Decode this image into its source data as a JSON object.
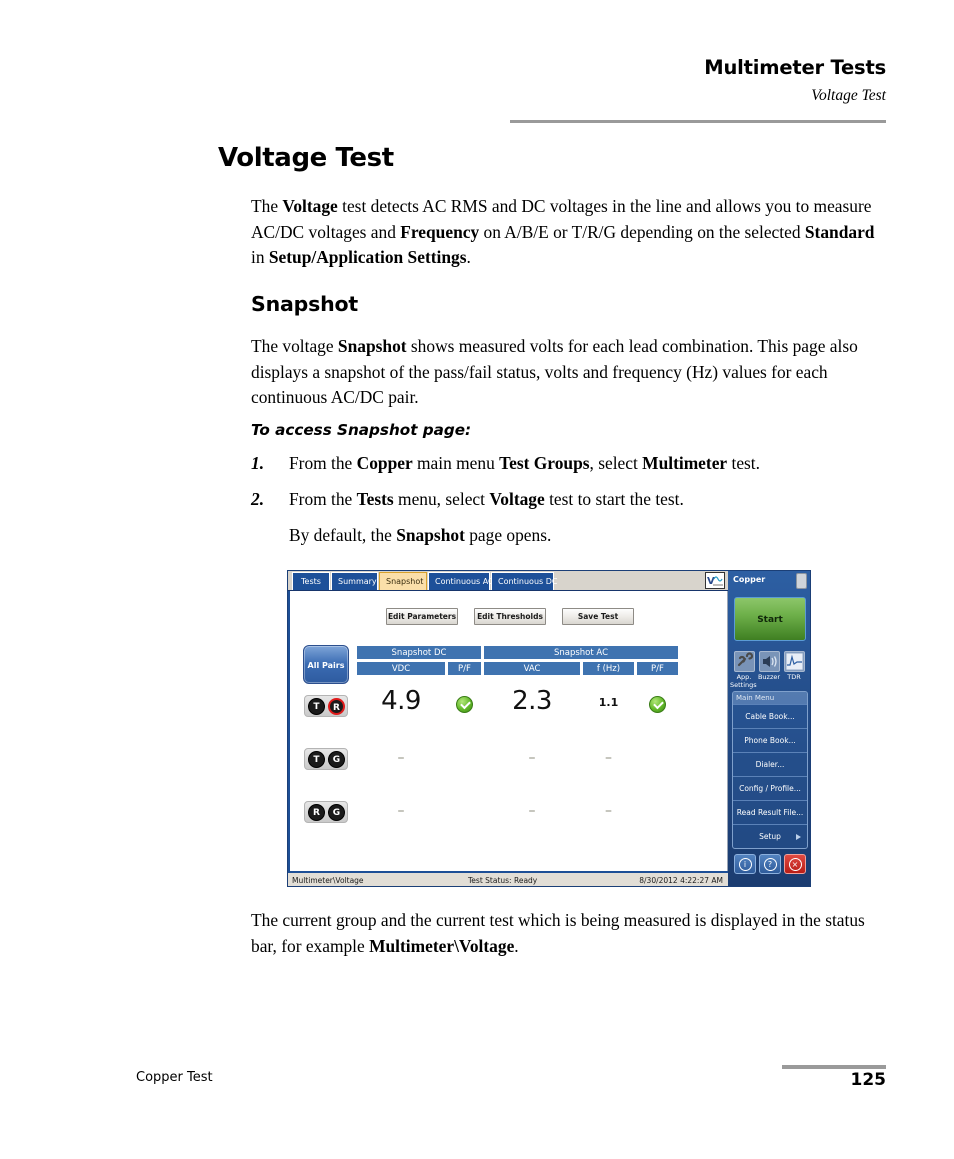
{
  "header": {
    "title": "Multimeter Tests",
    "subtitle": "Voltage Test"
  },
  "page_title": "Voltage Test",
  "intro_paragraph": {
    "parts": [
      {
        "t": "The ",
        "b": false
      },
      {
        "t": "Voltage",
        "b": true
      },
      {
        "t": " test detects AC RMS and DC voltages in the line and allows you to measure AC/DC voltages and ",
        "b": false
      },
      {
        "t": "Frequency",
        "b": true
      },
      {
        "t": " on A/B/E or T/R/G depending on the selected ",
        "b": false
      },
      {
        "t": "Standard",
        "b": true
      },
      {
        "t": " in ",
        "b": false
      },
      {
        "t": "Setup/Application Settings",
        "b": true
      },
      {
        "t": ".",
        "b": false
      }
    ]
  },
  "snapshot_heading": "Snapshot",
  "snapshot_paragraph": {
    "parts": [
      {
        "t": "The voltage ",
        "b": false
      },
      {
        "t": "Snapshot",
        "b": true
      },
      {
        "t": " shows measured volts for each lead combination. This page also displays a snapshot of the pass/fail status, volts and frequency (Hz) values for each continuous AC/DC pair.",
        "b": false
      }
    ]
  },
  "procedure_title": "To access Snapshot page:",
  "steps": [
    {
      "num": "1.",
      "parts": [
        {
          "t": "From the ",
          "b": false
        },
        {
          "t": "Copper",
          "b": true
        },
        {
          "t": " main menu ",
          "b": false
        },
        {
          "t": "Test Groups",
          "b": true
        },
        {
          "t": ", select ",
          "b": false
        },
        {
          "t": "Multimeter",
          "b": true
        },
        {
          "t": " test.",
          "b": false
        }
      ]
    },
    {
      "num": "2.",
      "parts": [
        {
          "t": "From the ",
          "b": false
        },
        {
          "t": "Tests",
          "b": true
        },
        {
          "t": " menu, select ",
          "b": false
        },
        {
          "t": "Voltage",
          "b": true
        },
        {
          "t": " test to start the test.",
          "b": false
        }
      ]
    },
    {
      "num": "",
      "parts": [
        {
          "t": "By default, the ",
          "b": false
        },
        {
          "t": "Snapshot",
          "b": true
        },
        {
          "t": " page opens.",
          "b": false
        }
      ]
    }
  ],
  "closing_paragraph": {
    "parts": [
      {
        "t": "The current group and the current test which is being measured is displayed in the status bar, for example ",
        "b": false
      },
      {
        "t": "Multimeter\\Voltage",
        "b": true
      },
      {
        "t": ".",
        "b": false
      }
    ]
  },
  "footer": {
    "left": "Copper Test",
    "page_number": "125"
  },
  "device_screenshot": {
    "tabs": [
      {
        "label": "Tests",
        "active": false
      },
      {
        "label": "Summary",
        "active": false
      },
      {
        "label": "Snapshot",
        "active": true
      },
      {
        "label": "Continuous AC",
        "active": false
      },
      {
        "label": "Continuous DC",
        "active": false
      }
    ],
    "toolbar_buttons": [
      "Edit Parameters",
      "Edit Thresholds",
      "Save Test"
    ],
    "all_pairs_label": "All Pairs",
    "group_headers": [
      {
        "label": "Snapshot DC"
      },
      {
        "label": "Snapshot AC"
      }
    ],
    "column_headers": [
      "VDC",
      "P/F",
      "VAC",
      "f (Hz)",
      "P/F"
    ],
    "rows": [
      {
        "pair": [
          "T",
          "R"
        ],
        "pair_styles": [
          "dark",
          "red"
        ],
        "vdc": "4.9",
        "dc_pf": "pass",
        "vac": "2.3",
        "freq": "1.1",
        "ac_pf": "pass"
      },
      {
        "pair": [
          "T",
          "G"
        ],
        "pair_styles": [
          "dark",
          "dark"
        ],
        "vdc": "–",
        "dc_pf": "none",
        "vac": "–",
        "freq": "–",
        "ac_pf": "none"
      },
      {
        "pair": [
          "R",
          "G"
        ],
        "pair_styles": [
          "dark",
          "dark"
        ],
        "vdc": "–",
        "dc_pf": "none",
        "vac": "–",
        "freq": "–",
        "ac_pf": "none"
      }
    ],
    "status_bar": {
      "path": "Multimeter\\Voltage",
      "status": "Test Status: Ready",
      "timestamp": "8/30/2012 4:22:27 AM"
    },
    "sidebar": {
      "title": "Copper",
      "start_label": "Start",
      "quick_icons": [
        {
          "label": "App.",
          "label2": "Settings",
          "icon": "wrench-icon"
        },
        {
          "label": "Buzzer",
          "label2": "",
          "icon": "speaker-icon"
        },
        {
          "label": "TDR",
          "label2": "",
          "icon": "waveform-icon"
        }
      ],
      "menu_header": "Main Menu",
      "menu_items": [
        {
          "label": "Cable Book...",
          "arrow": false
        },
        {
          "label": "Phone Book...",
          "arrow": false
        },
        {
          "label": "Dialer...",
          "arrow": false
        },
        {
          "label": "Config / Profile...",
          "arrow": false
        },
        {
          "label": "Read Result File...",
          "arrow": false
        },
        {
          "label": "Setup",
          "arrow": true
        }
      ],
      "bottom_buttons": [
        {
          "glyph": "i",
          "name": "info-button"
        },
        {
          "glyph": "?",
          "name": "help-button"
        },
        {
          "glyph": "×",
          "name": "close-button"
        }
      ]
    },
    "colors": {
      "accent_blue": "#1d5099",
      "active_tab": "#fbdfa9",
      "header_blue": "#3f73b0",
      "start_green": "#6eb04a",
      "pass_green": "#62b828",
      "fail_red": "#e01b1b"
    }
  }
}
